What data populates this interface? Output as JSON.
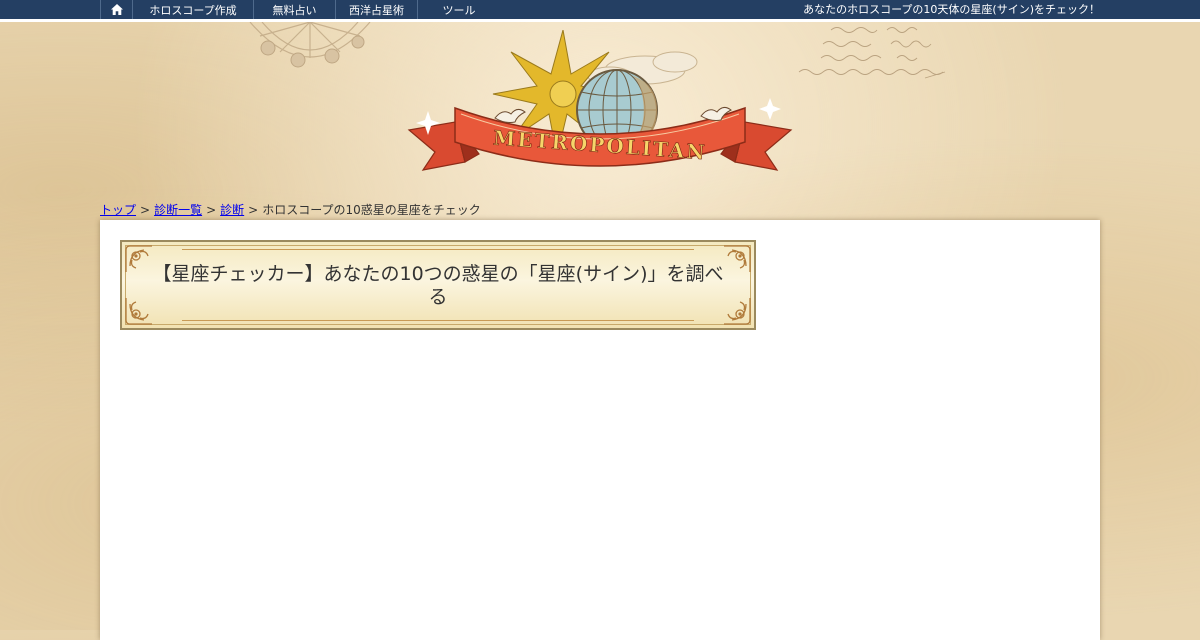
{
  "nav": {
    "home_icon": "home-icon",
    "items": [
      {
        "label": "ホロスコープ作成"
      },
      {
        "label": "無料占い"
      },
      {
        "label": "西洋占星術"
      },
      {
        "label": "ツール"
      }
    ],
    "tagline": "あなたのホロスコープの10天体の星座(サイン)をチェック！"
  },
  "logo": {
    "text": "METROPOLITAN",
    "icon": "globe-star-banner-logo"
  },
  "breadcrumb": {
    "items": [
      {
        "label": "トップ"
      },
      {
        "label": "診断一覧"
      },
      {
        "label": "診断"
      }
    ],
    "separator": ">",
    "current": "ホロスコープの10惑星の星座をチェック"
  },
  "main": {
    "title": "【星座チェッカー】あなたの10つの惑星の「星座(サイン)」を調べる"
  },
  "colors": {
    "nav_bg": "#243f63",
    "link": "#0000ee",
    "ribbon": "#e8583a",
    "frame_border": "#9b8a5e"
  }
}
